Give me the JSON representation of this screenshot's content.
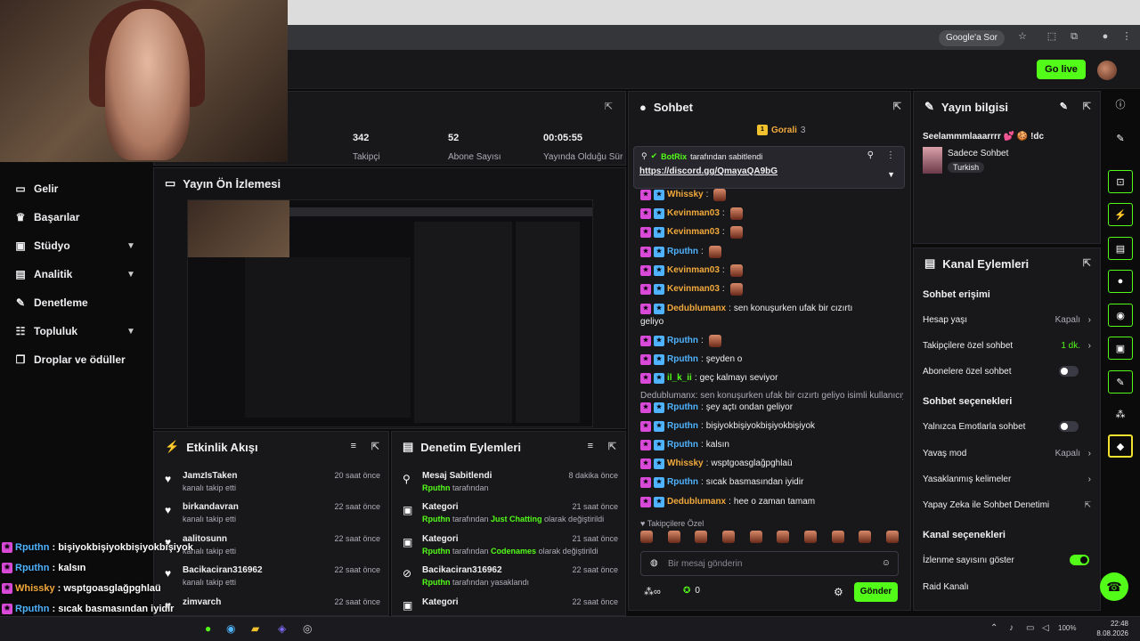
{
  "browser": {
    "google_sor": "Google'a Sor"
  },
  "topbar": {
    "go_live": "Go live"
  },
  "sidebar": {
    "items": [
      {
        "label": "Gelir",
        "icon": "wallet-icon"
      },
      {
        "label": "Başarılar",
        "icon": "trophy-icon"
      },
      {
        "label": "Stüdyo",
        "icon": "studio-icon"
      },
      {
        "label": "Analitik",
        "icon": "chart-icon"
      },
      {
        "label": "Denetleme",
        "icon": "wrench-icon"
      },
      {
        "label": "Topluluk",
        "icon": "community-icon"
      },
      {
        "label": "Droplar ve ödüller",
        "icon": "gift-icon"
      }
    ]
  },
  "stats": [
    {
      "value": "342",
      "label": "Takipçi"
    },
    {
      "value": "52",
      "label": "Abone Sayısı"
    },
    {
      "value": "00:05:55",
      "label": "Yayında Olduğu Süre"
    }
  ],
  "preview": {
    "title": "Yayın Ön İzlemesi"
  },
  "activity": {
    "title": "Etkinlik Akışı",
    "rows": [
      {
        "name": "JamzIsTaken",
        "sub": "kanalı takip etti",
        "time": "20 saat önce"
      },
      {
        "name": "birkandavran",
        "sub": "kanalı takip etti",
        "time": "22 saat önce"
      },
      {
        "name": "aalitosunn",
        "sub": "kanalı takip etti",
        "time": "22 saat önce"
      },
      {
        "name": "Bacikaciran316962",
        "sub": "kanalı takip etti",
        "time": "22 saat önce"
      },
      {
        "name": "zimvarch",
        "sub": "",
        "time": "22 saat önce"
      }
    ]
  },
  "moderation": {
    "title": "Denetim Eylemleri",
    "rows": [
      {
        "name": "Mesaj Sabitlendi",
        "by": "Rputhn",
        "rest": " tarafından",
        "time": "8 dakika önce"
      },
      {
        "name": "Kategori",
        "by": "Rputhn",
        "rest": " tarafından ",
        "hl": "Just Chatting",
        "rest2": " olarak değiştirildi",
        "time": "21 saat önce"
      },
      {
        "name": "Kategori",
        "by": "Rputhn",
        "rest": " tarafından ",
        "hl": "Codenames",
        "rest2": " olarak değiştirildi",
        "time": "21 saat önce"
      },
      {
        "name": "Bacikaciran316962",
        "by": "Rputhn",
        "rest": " tarafından yasaklandı",
        "time": "22 saat önce"
      },
      {
        "name": "Kategori",
        "by": "",
        "rest": "",
        "time": "22 saat önce"
      }
    ]
  },
  "chat": {
    "title": "Sohbet",
    "top_gifter": "Gorali",
    "top_gifter_count": "3",
    "pinned_by_name": "BotRix",
    "pinned_by_text": " tarafından sabitlendi",
    "pinned_link": "https://discord.gg/QmayaQA9bG",
    "messages": [
      {
        "user": "Whissky",
        "color": "#f2a93b",
        "text": ""
      },
      {
        "user": "Kevinman03",
        "color": "#f2a93b",
        "text": ""
      },
      {
        "user": "Kevinman03",
        "color": "#f2a93b",
        "text": ""
      },
      {
        "user": "Rputhn",
        "color": "#4fb3ff",
        "text": ""
      },
      {
        "user": "Kevinman03",
        "color": "#f2a93b",
        "text": ""
      },
      {
        "user": "Kevinman03",
        "color": "#f2a93b",
        "text": ""
      },
      {
        "user": "Dedublumanx",
        "color": "#f2a93b",
        "text": "sen konuşurken ufak bir cızırtı"
      },
      {
        "user": "",
        "color": "#efeff1",
        "text": "geliyo"
      },
      {
        "user": "Rputhn",
        "color": "#4fb3ff",
        "text": ""
      },
      {
        "user": "Rputhn",
        "color": "#4fb3ff",
        "text": "şeyden o"
      },
      {
        "user": "il_k_ii",
        "color": "#53fc18",
        "text": "geç kalmayı seviyor"
      },
      {
        "user": "",
        "color": "#adadb8",
        "text": "Dedublumanx: sen konuşurken ufak bir cızırtı geliyo isimli kullanıcıya y..."
      },
      {
        "user": "Rputhn",
        "color": "#4fb3ff",
        "text": "şey açtı ondan geliyor"
      },
      {
        "user": "Rputhn",
        "color": "#4fb3ff",
        "text": "bişiyokbişiyokbişiyokbişiyok"
      },
      {
        "user": "Rputhn",
        "color": "#4fb3ff",
        "text": "kalsın"
      },
      {
        "user": "Whissky",
        "color": "#f2a93b",
        "text": "wsptgoasglağpghlaü"
      },
      {
        "user": "Rputhn",
        "color": "#4fb3ff",
        "text": "sıcak basmasından iyidir"
      },
      {
        "user": "Dedublumanx",
        "color": "#f2a93b",
        "text": "hee o zaman tamam"
      }
    ],
    "follower_only": "Takipçilere Özel",
    "input_placeholder": "Bir mesaj gönderin",
    "count": "0",
    "send": "Gönder"
  },
  "info": {
    "title": "Yayın bilgisi",
    "stream_title": "Seelammmlaaarrrr 💕 🍪 !dc",
    "category": "Sadece Sohbet",
    "language": "Turkish"
  },
  "actions": {
    "title": "Kanal Eylemleri",
    "chat_access": "Sohbet erişimi",
    "account_age": "Hesap yaşı",
    "account_age_val": "Kapalı",
    "follower_chat": "Takipçilere özel sohbet",
    "follower_chat_val": "1 dk.",
    "sub_chat": "Abonelere özel sohbet",
    "chat_options": "Sohbet seçenekleri",
    "emote_only": "Yalnızca Emotlarla sohbet",
    "slow_mode": "Yavaş mod",
    "slow_mode_val": "Kapalı",
    "banned_words": "Yasaklanmış kelimeler",
    "ai_mod": "Yapay Zeka ile Sohbet Denetimi",
    "channel_options": "Kanal seçenekleri",
    "show_viewers": "İzlenme sayısını göster",
    "raid": "Raid Kanalı"
  },
  "overlay": [
    {
      "user": "Rputhn",
      "color": "#4fb3ff",
      "text": ": bişiyokbişiyokbişiyokbişiyok"
    },
    {
      "user": "Rputhn",
      "color": "#4fb3ff",
      "text": ": kalsın"
    },
    {
      "user": "Whissky",
      "color": "#f2a93b",
      "text": ": wsptgoasglağpghlaü"
    },
    {
      "user": "Rputhn",
      "color": "#4fb3ff",
      "text": ": sıcak basmasından iyidir"
    },
    {
      "user": "Dedublumanx",
      "color": "#f2a93b",
      "text": ": hee o zaman tamam"
    }
  ],
  "taskbar": {
    "battery": "100%",
    "time": "22:48",
    "date": "8.08.2026"
  },
  "colors": {
    "accent": "#53fc18",
    "panel": "#18181b"
  }
}
